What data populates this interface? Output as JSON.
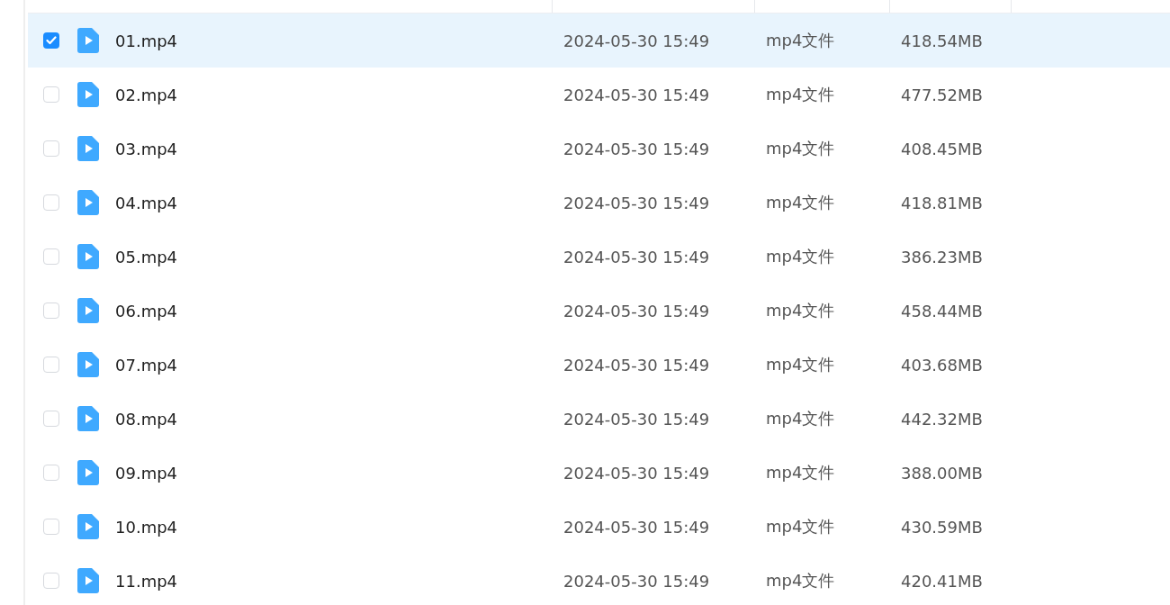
{
  "table": {
    "rows": [
      {
        "name": "01.mp4",
        "modified": "2024-05-30 15:49",
        "type": "mp4文件",
        "size": "418.54MB",
        "selected": true
      },
      {
        "name": "02.mp4",
        "modified": "2024-05-30 15:49",
        "type": "mp4文件",
        "size": "477.52MB",
        "selected": false
      },
      {
        "name": "03.mp4",
        "modified": "2024-05-30 15:49",
        "type": "mp4文件",
        "size": "408.45MB",
        "selected": false
      },
      {
        "name": "04.mp4",
        "modified": "2024-05-30 15:49",
        "type": "mp4文件",
        "size": "418.81MB",
        "selected": false
      },
      {
        "name": "05.mp4",
        "modified": "2024-05-30 15:49",
        "type": "mp4文件",
        "size": "386.23MB",
        "selected": false
      },
      {
        "name": "06.mp4",
        "modified": "2024-05-30 15:49",
        "type": "mp4文件",
        "size": "458.44MB",
        "selected": false
      },
      {
        "name": "07.mp4",
        "modified": "2024-05-30 15:49",
        "type": "mp4文件",
        "size": "403.68MB",
        "selected": false
      },
      {
        "name": "08.mp4",
        "modified": "2024-05-30 15:49",
        "type": "mp4文件",
        "size": "442.32MB",
        "selected": false
      },
      {
        "name": "09.mp4",
        "modified": "2024-05-30 15:49",
        "type": "mp4文件",
        "size": "388.00MB",
        "selected": false
      },
      {
        "name": "10.mp4",
        "modified": "2024-05-30 15:49",
        "type": "mp4文件",
        "size": "430.59MB",
        "selected": false
      },
      {
        "name": "11.mp4",
        "modified": "2024-05-30 15:49",
        "type": "mp4文件",
        "size": "420.41MB",
        "selected": false
      }
    ]
  }
}
